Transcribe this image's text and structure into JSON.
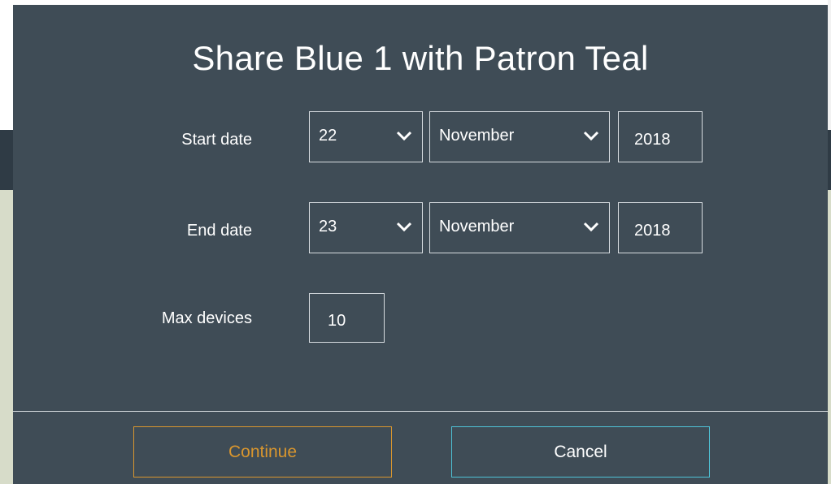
{
  "dialog": {
    "title": "Share Blue 1 with Patron Teal"
  },
  "start_date": {
    "label": "Start date",
    "day": "22",
    "month": "November",
    "year": "2018"
  },
  "end_date": {
    "label": "End date",
    "day": "23",
    "month": "November",
    "year": "2018"
  },
  "max_devices": {
    "label": "Max devices",
    "value": "10"
  },
  "footer": {
    "continue_label": "Continue",
    "cancel_label": "Cancel"
  },
  "colors": {
    "dialog_bg": "#3f4c56",
    "continue_accent": "#d9962e",
    "cancel_accent": "#4fc3d7",
    "border": "#d7dce0"
  },
  "icons": {
    "dropdown": "chevron-down-icon"
  }
}
